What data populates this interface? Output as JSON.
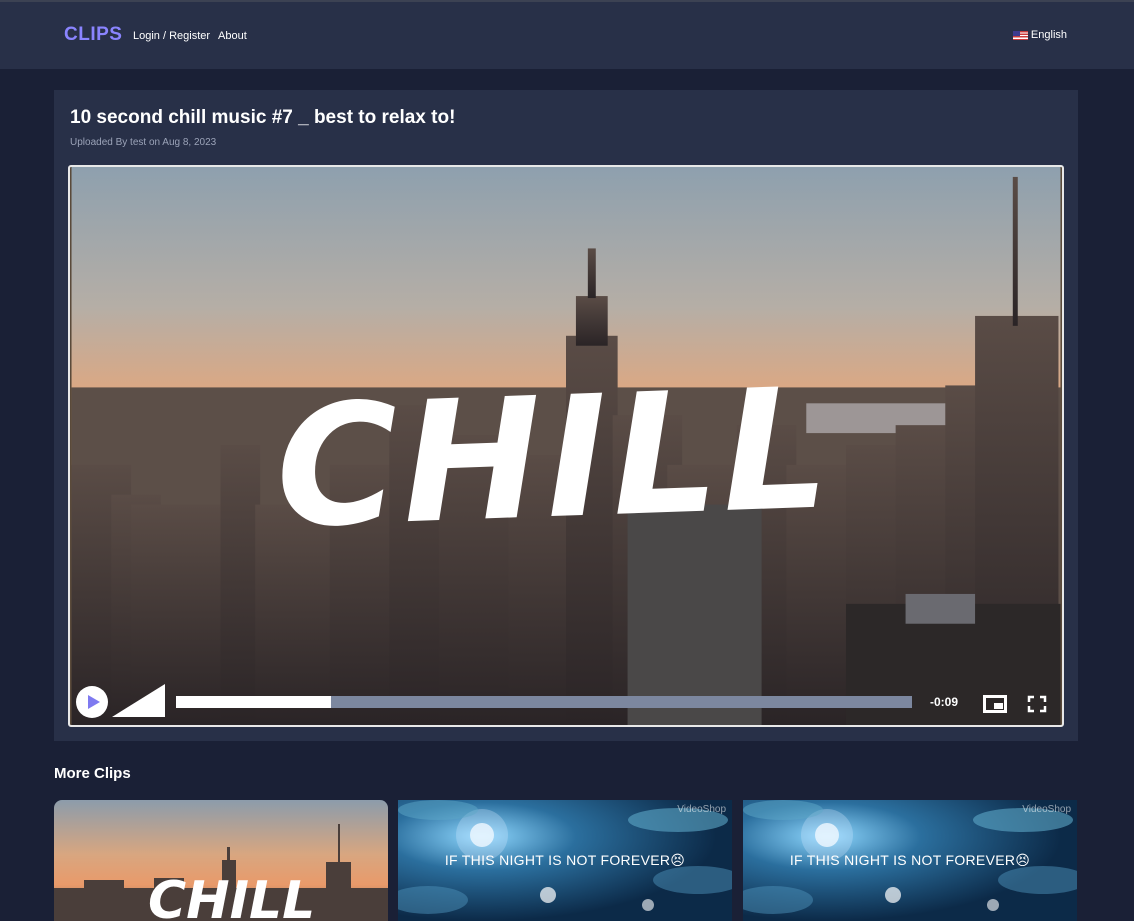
{
  "app": {
    "logo": "CLIPS"
  },
  "nav": {
    "login": "Login / Register",
    "about": "About",
    "language": "English"
  },
  "video": {
    "title": "10 second chill music #7 _ best to relax to!",
    "uploaded_by_label": "Uploaded By test",
    "uploaded_on_label": "on Aug 8, 2023",
    "overlay_text": "CHILL",
    "progress": 0.21,
    "time_remaining": "-0:09"
  },
  "more_clips": {
    "title": "More Clips",
    "items": [
      {
        "overlay_text": "CHILL",
        "watermark": ""
      },
      {
        "overlay_text": "IF THIS NIGHT IS NOT FOREVER😣",
        "watermark": "VideoShop"
      },
      {
        "overlay_text": "IF THIS NIGHT IS NOT FOREVER😣",
        "watermark": "VideoShop"
      }
    ]
  },
  "colors": {
    "page_bg": "#1a2036",
    "nav_bg": "#283048",
    "card_bg": "#283048",
    "logo": "#8a84ff",
    "play_icon": "#7f7af0",
    "progress_track": "#7c879f",
    "meta_text": "#9ba3b8"
  },
  "icons": [
    "play-icon",
    "volume-icon",
    "picture-in-picture-icon",
    "fullscreen-icon",
    "us-flag-icon"
  ]
}
